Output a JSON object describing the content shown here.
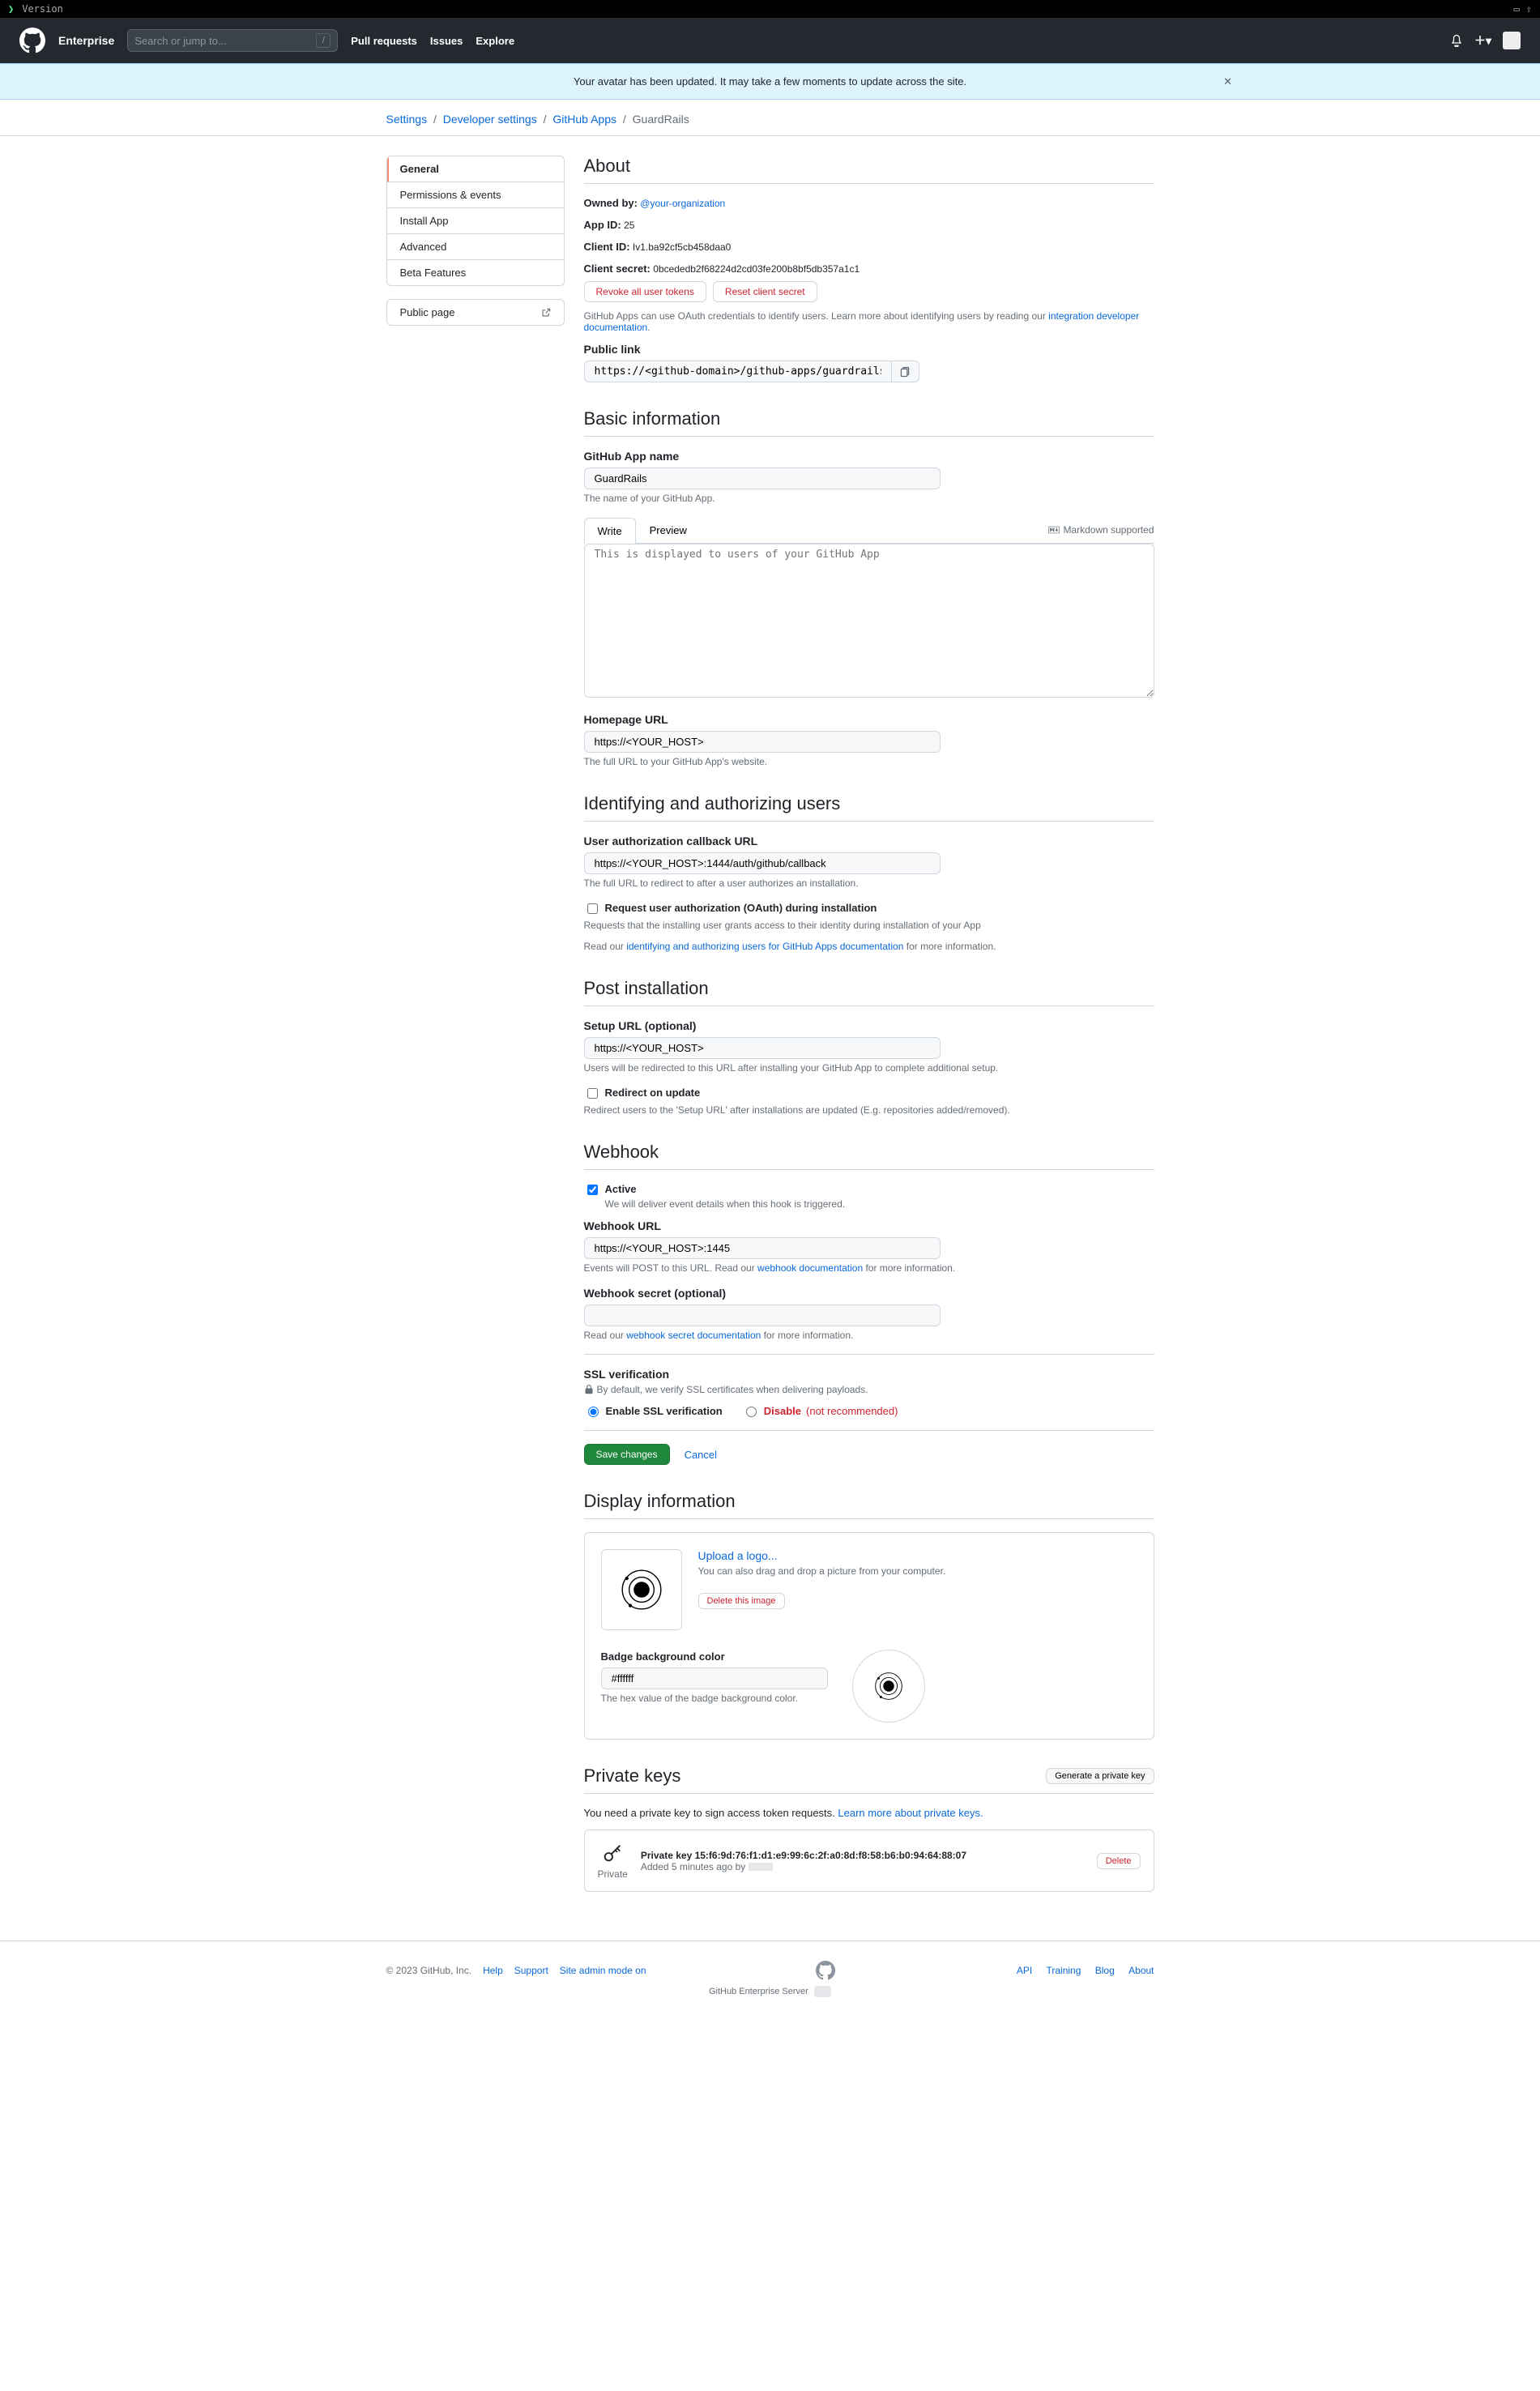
{
  "terminal": {
    "prompt": "❯",
    "cmd": "Version"
  },
  "header": {
    "brand": "Enterprise",
    "search_placeholder": "Search or jump to...",
    "nav": {
      "pulls": "Pull requests",
      "issues": "Issues",
      "explore": "Explore"
    }
  },
  "flash": {
    "message": "Your avatar has been updated. It may take a few moments to update across the site."
  },
  "crumbs": {
    "settings": "Settings",
    "dev_settings": "Developer settings",
    "gh_apps": "GitHub Apps",
    "current": "GuardRails"
  },
  "sidenav": {
    "general": "General",
    "perm": "Permissions & events",
    "install": "Install App",
    "advanced": "Advanced",
    "beta": "Beta Features",
    "public": "Public page"
  },
  "about": {
    "heading": "About",
    "owned_by_label": "Owned by:",
    "owner": "@your-organization",
    "app_id_label": "App ID:",
    "app_id": "25",
    "client_id_label": "Client ID:",
    "client_id": "Iv1.ba92cf5cb458daa0",
    "client_secret_label": "Client secret:",
    "client_secret": "0bcededb2f68224d2cd03fe200b8bf5db357a1c1",
    "revoke_btn": "Revoke all user tokens",
    "reset_btn": "Reset client secret",
    "oauth_note_1": "GitHub Apps can use OAuth credentials to identify users. Learn more about identifying users by reading our ",
    "oauth_link": "integration developer documentation",
    "public_link_label": "Public link",
    "public_link_value": "https://<github-domain>/github-apps/guardrails"
  },
  "basic": {
    "heading": "Basic information",
    "name_label": "GitHub App name",
    "name_value": "GuardRails",
    "name_note": "The name of your GitHub App.",
    "write_tab": "Write",
    "preview_tab": "Preview",
    "md_hint": "Markdown supported",
    "desc_placeholder": "This is displayed to users of your GitHub App",
    "home_label": "Homepage URL",
    "home_value": "https://<YOUR_HOST>",
    "home_note": "The full URL to your GitHub App's website."
  },
  "identify": {
    "heading": "Identifying and authorizing users",
    "cb_label": "User authorization callback URL",
    "cb_value": "https://<YOUR_HOST>:1444/auth/github/callback",
    "cb_note": "The full URL to redirect to after a user authorizes an installation.",
    "req_oauth_label": "Request user authorization (OAuth) during installation",
    "req_oauth_note_1": "Requests that the installing user grants access to their identity during installation of your App",
    "req_oauth_note_2a": "Read our ",
    "req_oauth_link": "identifying and authorizing users for GitHub Apps documentation",
    "req_oauth_note_2b": " for more information."
  },
  "post": {
    "heading": "Post installation",
    "setup_label": "Setup URL (optional)",
    "setup_value": "https://<YOUR_HOST>",
    "setup_note": "Users will be redirected to this URL after installing your GitHub App to complete additional setup.",
    "redir_label": "Redirect on update",
    "redir_note": "Redirect users to the 'Setup URL' after installations are updated (E.g. repositories added/removed)."
  },
  "webhook": {
    "heading": "Webhook",
    "active_label": "Active",
    "active_note": "We will deliver event details when this hook is triggered.",
    "url_label": "Webhook URL",
    "url_value": "https://<YOUR_HOST>:1445",
    "url_note_1": "Events will POST to this URL. Read our ",
    "url_link": "webhook documentation",
    "url_note_2": " for more information.",
    "secret_label": "Webhook secret (optional)",
    "secret_note_1": "Read our ",
    "secret_link": "webhook secret documentation",
    "secret_note_2": " for more information.",
    "ssl_heading": "SSL verification",
    "ssl_note": "By default, we verify SSL certificates when delivering payloads.",
    "ssl_enable": "Enable SSL verification",
    "ssl_disable": "Disable",
    "ssl_disable_hint": "(not recommended)"
  },
  "actions": {
    "save": "Save changes",
    "cancel": "Cancel"
  },
  "display": {
    "heading": "Display information",
    "upload": "Upload a logo...",
    "drag_note": "You can also drag and drop a picture from your computer.",
    "delete": "Delete this image",
    "badge_label": "Badge background color",
    "badge_value": "#ffffff",
    "badge_note": "The hex value of the badge background color."
  },
  "keys": {
    "heading": "Private keys",
    "generate": "Generate a private key",
    "need_note_1": "You need a private key to sign access token requests. ",
    "learn_link": "Learn more about private keys.",
    "fingerprint_label": "Private key 15:f6:9d:76:f1:d1:e9:99:6c:2f:a0:8d:f8:58:b6:b0:94:64:88:07",
    "added": "Added 5 minutes ago by ",
    "private_word": "Private",
    "delete": "Delete"
  },
  "footer": {
    "copyright": "© 2023 GitHub, Inc.",
    "help": "Help",
    "support": "Support",
    "admin": "Site admin mode on",
    "api": "API",
    "training": "Training",
    "blog": "Blog",
    "about": "About",
    "ghe": "GitHub Enterprise Server"
  }
}
